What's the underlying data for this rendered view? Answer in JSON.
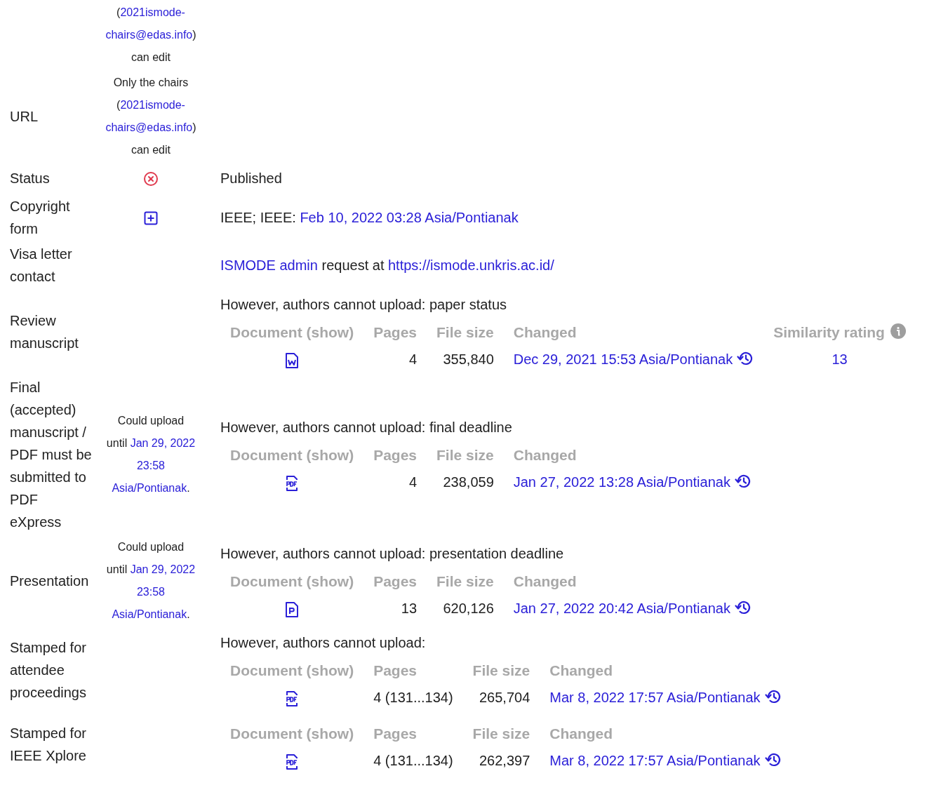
{
  "rows": [
    {
      "note": [
        [
          {
            "text": "(",
            "link": false
          },
          {
            "text": "2021ismode-",
            "link": true
          }
        ],
        [
          {
            "text": "chairs@edas.info",
            "link": true
          },
          {
            "text": ")",
            "link": false
          }
        ],
        [
          {
            "text": "can edit",
            "link": false
          }
        ]
      ]
    },
    {
      "label": "URL",
      "note": [
        [
          {
            "text": "Only the chairs",
            "link": false
          }
        ],
        [
          {
            "text": "(",
            "link": false
          },
          {
            "text": "2021ismode-",
            "link": true
          }
        ],
        [
          {
            "text": "chairs@edas.info",
            "link": true
          },
          {
            "text": ")",
            "link": false
          }
        ],
        [
          {
            "text": "can edit",
            "link": false
          }
        ]
      ]
    },
    {
      "label": "Status",
      "kind": "cancelled",
      "content": [
        {
          "text": "Published",
          "link": false
        }
      ]
    },
    {
      "label": "Copyright form",
      "kind": "addable",
      "content": [
        {
          "text": "IEEE; IEEE: ",
          "link": false
        },
        {
          "text": "Feb 10, 2022 03:28 Asia/Pontianak",
          "link": true
        }
      ]
    },
    {
      "label": "Visa letter contact",
      "content": [
        {
          "text": "ISMODE admin",
          "link": true
        },
        {
          "text": " request at ",
          "link": false
        },
        {
          "text": "https://ismode.unkris.ac.id/",
          "link": true
        }
      ]
    },
    {
      "label": "Review manuscript",
      "content": [
        {
          "text": "However, authors cannot upload: paper status",
          "link": false
        }
      ],
      "table": {
        "columns": [
          {
            "label": "Document (show)"
          },
          {
            "label": "Pages"
          },
          {
            "label": "File size"
          },
          {
            "label": "Changed"
          },
          {
            "label": "Similarity rating",
            "info": true
          }
        ],
        "rows": [
          {
            "kind": "word",
            "pages": "4",
            "file_size": "355,840",
            "changed": "Dec 29, 2021 15:53 Asia/Pontianak",
            "similarity": "13"
          }
        ]
      }
    },
    {
      "label": "Final (accepted) manuscript / PDF must be submitted to PDF eXpress",
      "note": [
        [
          {
            "text": "Could upload",
            "link": false
          }
        ],
        [
          {
            "text": "until ",
            "link": false
          },
          {
            "text": "Jan 29, 2022",
            "link": true
          }
        ],
        [
          {
            "text": "23:58",
            "link": true
          }
        ],
        [
          {
            "text": "Asia/Pontianak",
            "link": true
          },
          {
            "text": ".",
            "link": false
          }
        ]
      ],
      "content": [
        {
          "text": "However, authors cannot upload: final deadline",
          "link": false
        }
      ],
      "table": {
        "columns": [
          {
            "label": "Document (show)"
          },
          {
            "label": "Pages"
          },
          {
            "label": "File size"
          },
          {
            "label": "Changed"
          }
        ],
        "rows": [
          {
            "kind": "pdf",
            "pages": "4",
            "file_size": "238,059",
            "changed": "Jan 27, 2022 13:28 Asia/Pontianak"
          }
        ]
      }
    },
    {
      "label": "Presentation",
      "note": [
        [
          {
            "text": "Could upload",
            "link": false
          }
        ],
        [
          {
            "text": "until ",
            "link": false
          },
          {
            "text": "Jan 29, 2022",
            "link": true
          }
        ],
        [
          {
            "text": "23:58",
            "link": true
          }
        ],
        [
          {
            "text": "Asia/Pontianak",
            "link": true
          },
          {
            "text": ".",
            "link": false
          }
        ]
      ],
      "content": [
        {
          "text": "However, authors cannot upload: presentation deadline",
          "link": false
        }
      ],
      "table": {
        "columns": [
          {
            "label": "Document (show)"
          },
          {
            "label": "Pages"
          },
          {
            "label": "File size"
          },
          {
            "label": "Changed"
          }
        ],
        "rows": [
          {
            "kind": "slides",
            "pages": "13",
            "file_size": "620,126",
            "changed": "Jan 27, 2022 20:42 Asia/Pontianak"
          }
        ]
      }
    },
    {
      "label": "Stamped for attendee proceedings",
      "content": [
        {
          "text": "However, authors cannot upload:",
          "link": false
        }
      ],
      "table": {
        "columns": [
          {
            "label": "Document (show)"
          },
          {
            "label": "Pages"
          },
          {
            "label": "File size"
          },
          {
            "label": "Changed"
          }
        ],
        "rows": [
          {
            "kind": "pdf",
            "pages": "4 (131...134)",
            "file_size": "265,704",
            "changed": "Mar 8, 2022 17:57 Asia/Pontianak"
          }
        ]
      }
    },
    {
      "label": "Stamped for IEEE Xplore",
      "table": {
        "columns": [
          {
            "label": "Document (show)"
          },
          {
            "label": "Pages"
          },
          {
            "label": "File size"
          },
          {
            "label": "Changed"
          }
        ],
        "rows": [
          {
            "kind": "pdf",
            "pages": "4 (131...134)",
            "file_size": "262,397",
            "changed": "Mar 8, 2022 17:57 Asia/Pontianak"
          }
        ]
      }
    }
  ]
}
